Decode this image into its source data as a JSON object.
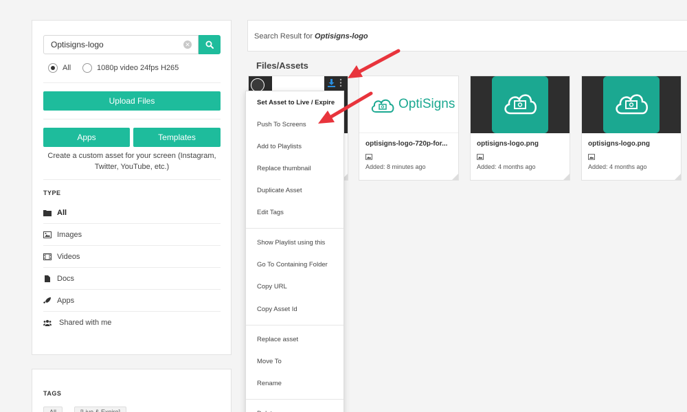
{
  "search": {
    "value": "Optisigns-logo",
    "clear_icon": "times-icon",
    "button_icon": "search-icon"
  },
  "filters": {
    "all_label": "All",
    "video_label": "1080p video 24fps H265",
    "selected": "All"
  },
  "buttons": {
    "upload": "Upload Files",
    "apps": "Apps",
    "templates": "Templates"
  },
  "custom_asset_text": "Create a custom asset for your screen (Instagram, Twitter, YouTube, etc.)",
  "type_section": {
    "title": "TYPE",
    "items": [
      {
        "label": "All",
        "icon": "folder-icon"
      },
      {
        "label": "Images",
        "icon": "image-icon"
      },
      {
        "label": "Videos",
        "icon": "film-icon"
      },
      {
        "label": "Docs",
        "icon": "document-icon"
      },
      {
        "label": "Apps",
        "icon": "rocket-icon"
      },
      {
        "label": "Shared with me",
        "icon": "users-icon"
      }
    ]
  },
  "tags_section": {
    "title": "TAGS",
    "chips": [
      "All",
      "[Live & Expire]"
    ]
  },
  "results": {
    "prefix": "Search Result for",
    "query": "Optisigns-logo",
    "heading": "Files/Assets"
  },
  "assets": [
    {
      "name": "",
      "added": ""
    },
    {
      "name": "optisigns-logo-720p-for...",
      "added": "Added: 8 minutes ago",
      "logo_text": "OptiSigns"
    },
    {
      "name": "optisigns-logo.png",
      "added": "Added: 4 months ago"
    },
    {
      "name": "optisigns-logo.png",
      "added": "Added: 4 months ago"
    }
  ],
  "context_menu": {
    "items": [
      "Set Asset to Live / Expire",
      "Push To Screens",
      "Add to Playlists",
      "Replace thumbnail",
      "Duplicate Asset",
      "Edit Tags",
      "Show Playlist using this",
      "Go To Containing Folder",
      "Copy URL",
      "Copy Asset Id",
      "Replace asset",
      "Move To",
      "Rename",
      "Delete"
    ]
  },
  "colors": {
    "accent": "#1ebc9c",
    "arrow": "#e8343c",
    "brand_teal": "#1ba891"
  }
}
